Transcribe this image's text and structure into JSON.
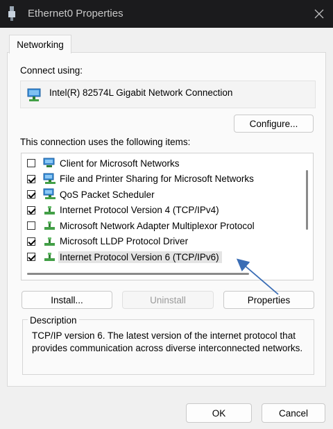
{
  "window": {
    "title": "Ethernet0 Properties"
  },
  "tabs": [
    {
      "label": "Networking"
    }
  ],
  "connect_using": {
    "label": "Connect using:",
    "adapter": "Intel(R) 82574L Gigabit Network Connection",
    "configure_label": "Configure..."
  },
  "items_label": "This connection uses the following items:",
  "items": [
    {
      "label": "Client for Microsoft Networks",
      "checked": false,
      "icon": "network-client-icon"
    },
    {
      "label": "File and Printer Sharing for Microsoft Networks",
      "checked": true,
      "icon": "network-service-icon"
    },
    {
      "label": "QoS Packet Scheduler",
      "checked": true,
      "icon": "network-service-icon"
    },
    {
      "label": "Internet Protocol Version 4 (TCP/IPv4)",
      "checked": true,
      "icon": "protocol-icon"
    },
    {
      "label": "Microsoft Network Adapter Multiplexor Protocol",
      "checked": false,
      "icon": "protocol-icon"
    },
    {
      "label": "Microsoft LLDP Protocol Driver",
      "checked": true,
      "icon": "protocol-icon"
    },
    {
      "label": "Internet Protocol Version 6 (TCP/IPv6)",
      "checked": true,
      "icon": "protocol-icon",
      "selected": true
    }
  ],
  "buttons": {
    "install": "Install...",
    "uninstall": "Uninstall",
    "properties": "Properties",
    "ok": "OK",
    "cancel": "Cancel"
  },
  "description": {
    "legend": "Description",
    "text": "TCP/IP version 6. The latest version of the internet protocol that provides communication across diverse interconnected networks."
  },
  "colors": {
    "titlebar": "#1b1b1d",
    "annotation_arrow": "#3a6db5"
  }
}
